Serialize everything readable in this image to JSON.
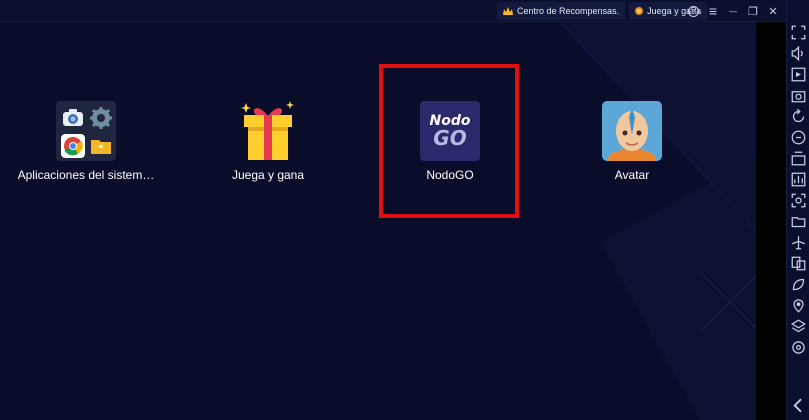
{
  "titlebar": {
    "rewards_label": "Centro de Recompensas.",
    "play_label": "Juega y gana",
    "buttons": [
      {
        "name": "help-icon",
        "glyph": "?"
      },
      {
        "name": "menu-icon",
        "glyph": "≡"
      },
      {
        "name": "minimize-icon",
        "glyph": "—"
      },
      {
        "name": "restore-icon",
        "glyph": "❐"
      },
      {
        "name": "close-icon",
        "glyph": "✕"
      },
      {
        "name": "collapse-sidebar-icon",
        "glyph": "«"
      }
    ]
  },
  "apps": [
    {
      "name": "app-system-apps",
      "label": "Aplicaciones del sistem…"
    },
    {
      "name": "app-juega-y-gana",
      "label": "Juega y gana"
    },
    {
      "name": "app-nodogo",
      "label": "NodoGO",
      "icon_text_1": "Nodo",
      "icon_text_2": "GO"
    },
    {
      "name": "app-avatar",
      "label": "Avatar"
    }
  ],
  "sidebar": {
    "icons": [
      "fullscreen-icon",
      "volume-icon",
      "media-icon",
      "screenshot-icon",
      "rotate-icon",
      "sync-icon",
      "macro-icon",
      "performance-icon",
      "capture-icon",
      "folder-icon",
      "airplane-icon",
      "multi-instance-icon",
      "eco-mode-icon",
      "location-icon",
      "layers-icon",
      "settings-icon",
      "back-icon"
    ]
  },
  "colors": {
    "background": "#0a0d2a",
    "highlight": "#e01010",
    "nodo_bg": "#29296b"
  }
}
